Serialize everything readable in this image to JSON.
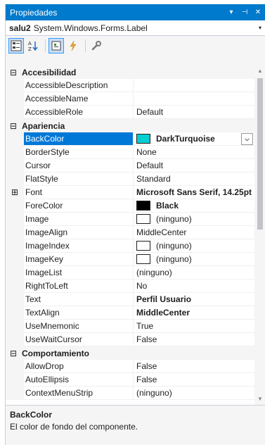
{
  "window": {
    "title": "Propiedades",
    "menu_glyph": "▾",
    "pin_glyph": "⊣",
    "close_glyph": "✕"
  },
  "object_selector": {
    "name": "salu2",
    "type": "System.Windows.Forms.Label",
    "arrow": "▾"
  },
  "toolbar": {
    "buttons": [
      "categorized-icon",
      "alphabetical-icon",
      "properties-icon",
      "events-icon",
      "property-pages-icon"
    ]
  },
  "grid": {
    "categories": {
      "accesibilidad": {
        "label": "Accesibilidad",
        "expander": "⊟"
      },
      "apariencia": {
        "label": "Apariencia",
        "expander": "⊟"
      },
      "comportamiento": {
        "label": "Comportamiento",
        "expander": "⊟"
      }
    },
    "properties": [
      {
        "name": "AccessibleDescription",
        "value": ""
      },
      {
        "name": "AccessibleName",
        "value": ""
      },
      {
        "name": "AccessibleRole",
        "value": "Default"
      },
      {
        "name": "BackColor",
        "value": "DarkTurquoise",
        "swatch": "#00ced1"
      },
      {
        "name": "BorderStyle",
        "value": "None"
      },
      {
        "name": "Cursor",
        "value": "Default"
      },
      {
        "name": "FlatStyle",
        "value": "Standard"
      },
      {
        "name": "Font",
        "value": "Microsoft Sans Serif, 14.25pt",
        "expander": "⊞"
      },
      {
        "name": "ForeColor",
        "value": "Black",
        "swatch": "#000000"
      },
      {
        "name": "Image",
        "value": "(ninguno)"
      },
      {
        "name": "ImageAlign",
        "value": "MiddleCenter"
      },
      {
        "name": "ImageIndex",
        "value": "(ninguno)"
      },
      {
        "name": "ImageKey",
        "value": "(ninguno)"
      },
      {
        "name": "ImageList",
        "value": "(ninguno)"
      },
      {
        "name": "RightToLeft",
        "value": "No"
      },
      {
        "name": "Text",
        "value": "Perfil Usuario"
      },
      {
        "name": "TextAlign",
        "value": "MiddleCenter"
      },
      {
        "name": "UseMnemonic",
        "value": "True"
      },
      {
        "name": "UseWaitCursor",
        "value": "False"
      },
      {
        "name": "AllowDrop",
        "value": "False"
      },
      {
        "name": "AutoEllipsis",
        "value": "False"
      },
      {
        "name": "ContextMenuStrip",
        "value": "(ninguno)"
      }
    ],
    "dropdown_arrow": "⌵"
  },
  "scrollbar": {
    "up": "▲",
    "down": "▼"
  },
  "description": {
    "title": "BackColor",
    "text": "El color de fondo del componente."
  },
  "colors": {
    "accent": "#007acc",
    "selection": "#0078d7"
  }
}
